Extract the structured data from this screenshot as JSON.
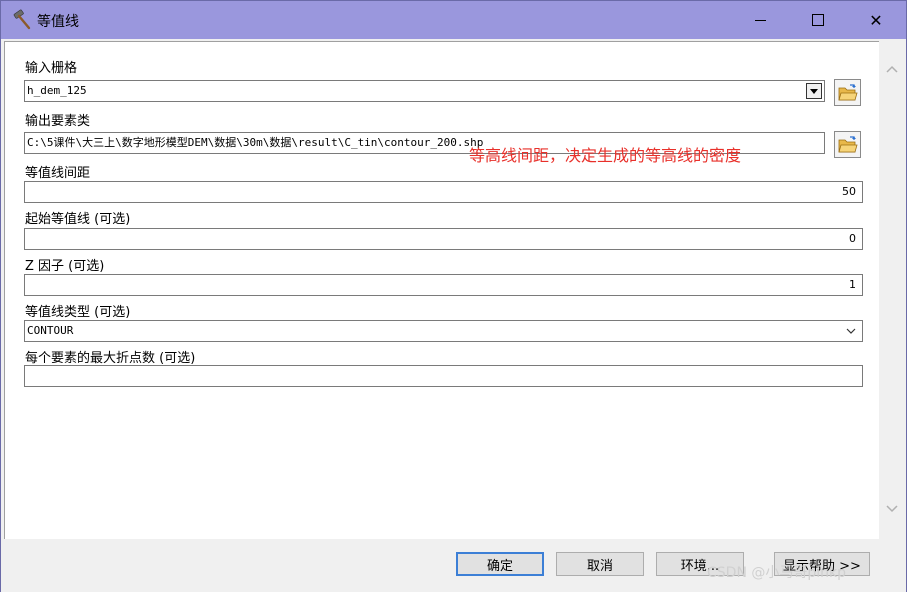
{
  "window": {
    "title": "等值线",
    "close_glyph": "✕"
  },
  "form": {
    "input_raster": {
      "label": "输入栅格",
      "value": "h_dem_125"
    },
    "output_features": {
      "label": "输出要素类",
      "value": "C:\\5课件\\大三上\\数字地形模型DEM\\数据\\30m\\数据\\result\\C_tin\\contour_200.shp"
    },
    "contour_interval": {
      "label": "等值线间距",
      "value": "50"
    },
    "base_contour": {
      "label": "起始等值线 (可选)",
      "value": "0"
    },
    "z_factor": {
      "label": "Z 因子 (可选)",
      "value": "1"
    },
    "contour_type": {
      "label": "等值线类型 (可选)",
      "value": "CONTOUR"
    },
    "max_vertices": {
      "label": "每个要素的最大折点数 (可选)",
      "value": ""
    }
  },
  "annotation": {
    "text": "等高线间距，决定生成的等高线的密度",
    "color": "#e8302a"
  },
  "buttons": {
    "ok": "确定",
    "cancel": "取消",
    "environments": "环境...",
    "show_help": "显示帮助 >>"
  },
  "watermark": "CSDN @小马哥pinkp",
  "colors": {
    "titlebar": "#9a97dd",
    "default_button_border": "#3c7fd6"
  }
}
